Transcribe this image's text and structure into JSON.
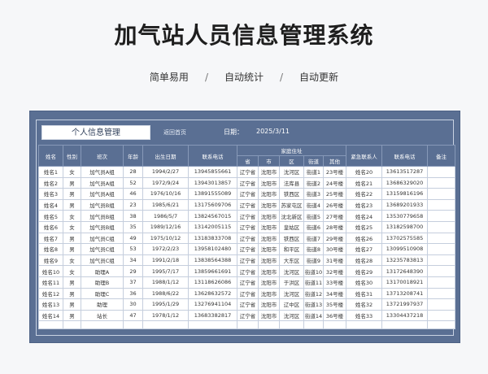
{
  "page": {
    "title": "加气站人员信息管理系统",
    "nav": [
      "简单易用",
      "自动统计",
      "自动更新"
    ]
  },
  "sheet": {
    "title": "个人信息管理",
    "group": "返回首页",
    "date_label": "日期：",
    "date_value": "2025/3/11",
    "headers": {
      "name": "姓名",
      "gender": "性别",
      "shift": "班次",
      "age": "年龄",
      "birth": "出生日期",
      "phone": "联系电话",
      "address": "家庭住址",
      "province": "省",
      "city": "市",
      "district": "区",
      "street": "街道",
      "other": "其他",
      "emergency": "紧急联系人",
      "emergency_phone": "联系电话",
      "note": "备注"
    },
    "rows": [
      [
        "姓名1",
        "女",
        "加气员A组",
        "28",
        "1994/2/27",
        "13945855661",
        "辽宁省",
        "沈阳市",
        "沈河区",
        "街道1",
        "23号楼",
        "姓名20",
        "13613517287",
        ""
      ],
      [
        "姓名2",
        "男",
        "加气员A组",
        "52",
        "1972/9/24",
        "13943013857",
        "辽宁省",
        "沈阳市",
        "法库县",
        "街道2",
        "24号楼",
        "姓名21",
        "13686329020",
        ""
      ],
      [
        "姓名3",
        "男",
        "加气员A组",
        "46",
        "1976/10/16",
        "13891555089",
        "辽宁省",
        "沈阳市",
        "铁西区",
        "街道3",
        "25号楼",
        "姓名22",
        "13159816196",
        ""
      ],
      [
        "姓名4",
        "男",
        "加气员B组",
        "23",
        "1985/6/21",
        "13175609706",
        "辽宁省",
        "沈阳市",
        "苏家屯区",
        "街道4",
        "26号楼",
        "姓名23",
        "13689201933",
        ""
      ],
      [
        "姓名5",
        "女",
        "加气员B组",
        "38",
        "1986/5/7",
        "13824567015",
        "辽宁省",
        "沈阳市",
        "沈北新区",
        "街道5",
        "27号楼",
        "姓名24",
        "13530779658",
        ""
      ],
      [
        "姓名6",
        "女",
        "加气员B组",
        "35",
        "1989/12/16",
        "13142005115",
        "辽宁省",
        "沈阳市",
        "皇姑区",
        "街道6",
        "28号楼",
        "姓名25",
        "13182598700",
        ""
      ],
      [
        "姓名7",
        "男",
        "加气员C组",
        "49",
        "1975/10/12",
        "13183833708",
        "辽宁省",
        "沈阳市",
        "铁西区",
        "街道7",
        "29号楼",
        "姓名26",
        "13702575585",
        ""
      ],
      [
        "姓名8",
        "男",
        "加气员C组",
        "53",
        "1972/2/23",
        "13958102480",
        "辽宁省",
        "沈阳市",
        "和平区",
        "街道8",
        "30号楼",
        "姓名27",
        "13099510908",
        ""
      ],
      [
        "姓名9",
        "女",
        "加气员C组",
        "34",
        "1991/2/18",
        "13838564388",
        "辽宁省",
        "沈阳市",
        "大东区",
        "街道9",
        "31号楼",
        "姓名28",
        "13235783813",
        ""
      ],
      [
        "姓名10",
        "女",
        "助理A",
        "29",
        "1995/7/17",
        "13859661691",
        "辽宁省",
        "沈阳市",
        "沈河区",
        "街道10",
        "32号楼",
        "姓名29",
        "13172648390",
        ""
      ],
      [
        "姓名11",
        "男",
        "助理B",
        "37",
        "1988/1/12",
        "13118626086",
        "辽宁省",
        "沈阳市",
        "于洪区",
        "街道11",
        "33号楼",
        "姓名30",
        "13170018921",
        ""
      ],
      [
        "姓名12",
        "男",
        "助理C",
        "36",
        "1988/6/22",
        "13628632572",
        "辽宁省",
        "沈阳市",
        "沈河区",
        "街道12",
        "34号楼",
        "姓名31",
        "13713208741",
        ""
      ],
      [
        "姓名13",
        "男",
        "助理",
        "30",
        "1995/1/29",
        "13276941104",
        "辽宁省",
        "沈阳市",
        "辽中区",
        "街道13",
        "35号楼",
        "姓名32",
        "13721997937",
        ""
      ],
      [
        "姓名14",
        "男",
        "站长",
        "47",
        "1978/1/12",
        "13683382817",
        "辽宁省",
        "沈阳市",
        "沈河区",
        "街道14",
        "36号楼",
        "姓名33",
        "13304437218",
        ""
      ]
    ]
  }
}
